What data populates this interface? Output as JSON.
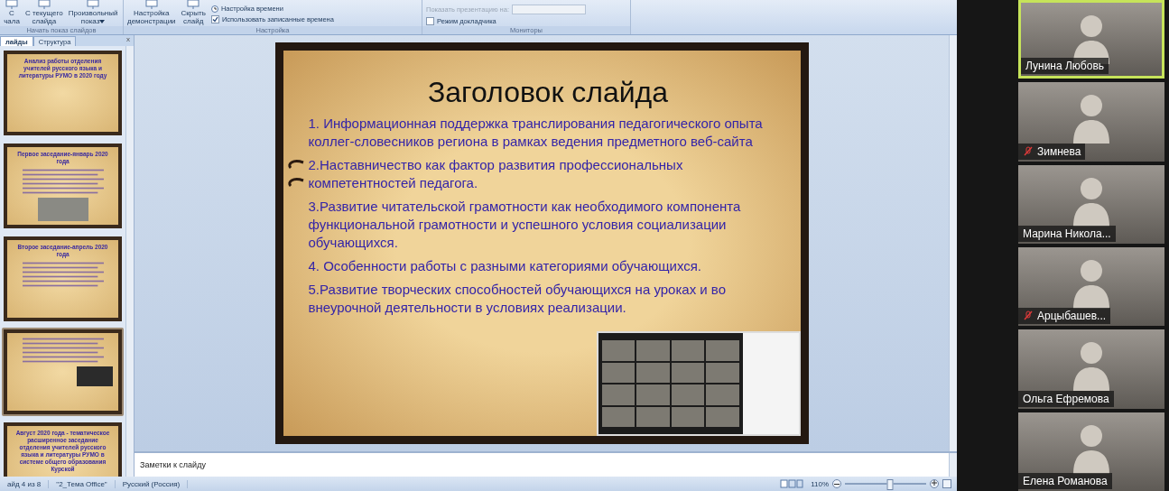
{
  "ribbon": {
    "groups": [
      {
        "label": "Начать показ слайдов",
        "buttons": [
          {
            "lines": [
              "С",
              "чала"
            ],
            "dropdown": false
          },
          {
            "lines": [
              "С текущего",
              "слайда"
            ],
            "dropdown": false
          },
          {
            "lines": [
              "Произвольный",
              "показ"
            ],
            "dropdown": true
          }
        ]
      },
      {
        "label": "Настройка",
        "buttons": [
          {
            "lines": [
              "Настройка",
              "демонстрации"
            ],
            "dropdown": false
          },
          {
            "lines": [
              "Скрыть",
              "слайд"
            ],
            "dropdown": false
          }
        ],
        "options": [
          {
            "kind": "command",
            "label": "Настройка времени",
            "disabled": false
          },
          {
            "kind": "checkbox",
            "label": "Использовать записанные времена",
            "checked": true,
            "disabled": false
          }
        ]
      },
      {
        "label": "Мониторы",
        "options": [
          {
            "kind": "select",
            "label": "Показать презентацию на:",
            "disabled": true
          },
          {
            "kind": "checkbox",
            "label": "Режим докладчика",
            "checked": false,
            "disabled": false
          }
        ]
      }
    ]
  },
  "panel": {
    "tabs": [
      {
        "label": "лайды",
        "selected": true
      },
      {
        "label": "Структура",
        "selected": false
      }
    ],
    "close": "x",
    "thumbnails": [
      {
        "title": "Анализ работы отделения учителей русского языка и литературы РУМО в 2020 году",
        "kind": "title",
        "selected": false
      },
      {
        "title": "Первое заседание-январь 2020 года",
        "kind": "photo",
        "selected": false
      },
      {
        "title": "Второе заседание-апрель 2020 года",
        "kind": "text",
        "selected": false
      },
      {
        "kind": "screen",
        "selected": true
      },
      {
        "title": "Август 2020 года - тематическое расширенное заседание отделения учителей русского языка и литературы РУМО в системе общего образования Курской",
        "kind": "title",
        "selected": false
      }
    ]
  },
  "slide": {
    "title": "Заголовок слайда",
    "items": [
      "1. Информационная поддержка транслирования педагогического опыта коллег-словесников региона в рамках ведения предметного веб-сайта",
      "2.Наставничество как фактор развития профессиональных компетентностей педагога.",
      "3.Развитие читательской грамотности как необходимого компонента функциональной грамотности  и успешного условия социализации обучающихся.",
      "4. Особенности работы с разными категориями обучающихся.",
      "5.Развитие творческих способностей обучающихся на уроках и во внеурочной деятельности в условиях реализации."
    ]
  },
  "notes": {
    "placeholder": "Заметки к слайду"
  },
  "status_bar": {
    "slide": "айд 4 из 8",
    "theme": "\"2_Тема Office\"",
    "language": "Русский (Россия)",
    "zoom": "110%",
    "zoom_slider": {
      "level": 0.55
    }
  },
  "participants": [
    {
      "name": "Лунина Любовь",
      "muted": false,
      "speaking": true
    },
    {
      "name": "Зимнева",
      "muted": true,
      "speaking": false
    },
    {
      "name": "Марина Никола...",
      "muted": false,
      "speaking": false
    },
    {
      "name": "Арцыбашев...",
      "muted": true,
      "speaking": false
    },
    {
      "name": "Ольга Ефремова",
      "muted": false,
      "speaking": false
    },
    {
      "name": "Елена Романова",
      "muted": false,
      "speaking": false
    }
  ]
}
